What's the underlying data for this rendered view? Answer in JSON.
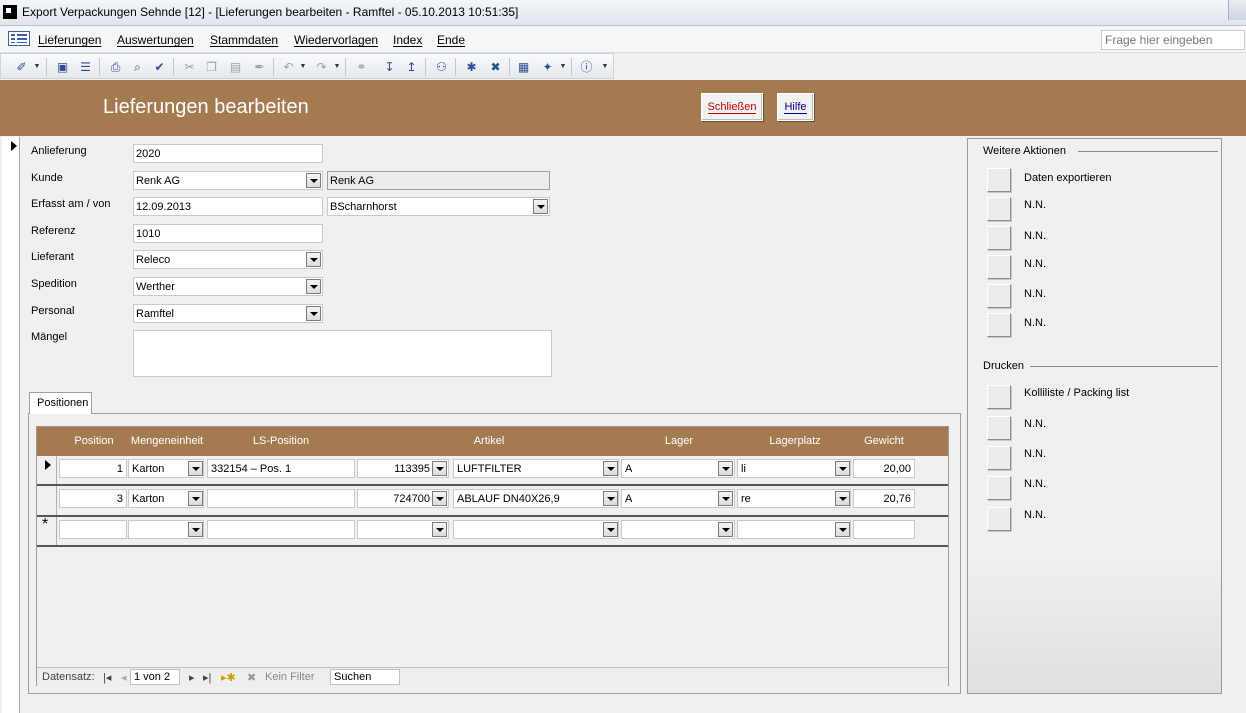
{
  "window": {
    "title": "Export Verpackungen Sehnde [12] - [Lieferungen bearbeiten - Ramftel - 05.10.2013 10:51:35]"
  },
  "menu": {
    "items": [
      "Lieferungen",
      "Auswertungen",
      "Stammdaten",
      "Wiedervorlagen",
      "Index",
      "Ende"
    ],
    "help_placeholder": "Frage hier eingeben"
  },
  "toolbar": {
    "icons": [
      "design-view-icon",
      "save-icon",
      "file-search-icon",
      "print-icon",
      "print-preview-icon",
      "spelling-icon",
      "cut-icon",
      "copy-icon",
      "paste-icon",
      "format-painter-icon",
      "undo-icon",
      "redo-icon",
      "hyperlink-icon",
      "sort-ascending-icon",
      "sort-descending-icon",
      "find-icon",
      "new-record-icon",
      "delete-record-icon",
      "database-window-icon",
      "new-object-icon",
      "help-icon"
    ]
  },
  "header": {
    "title": "Lieferungen bearbeiten",
    "close_label": "Schließen",
    "help_label": "Hilfe"
  },
  "form": {
    "anlieferung_label": "Anlieferung",
    "anlieferung": "2020",
    "kunde_label": "Kunde",
    "kunde": "Renk AG",
    "kunde_name": "Renk AG",
    "erfasst_label": "Erfasst am / von",
    "erfasst_am": "12.09.2013",
    "erfasst_von": "BScharnhorst",
    "referenz_label": "Referenz",
    "referenz": "1010",
    "lieferant_label": "Lieferant",
    "lieferant": "Releco",
    "spedition_label": "Spedition",
    "spedition": "Werther",
    "personal_label": "Personal",
    "personal": "Ramftel",
    "maengel_label": "Mängel",
    "maengel": ""
  },
  "tab": {
    "label": "Positionen"
  },
  "positions": {
    "columns": [
      "Position",
      "Mengeneinheit",
      "LS-Position",
      "Artikel",
      "Lager",
      "Lagerplatz",
      "Gewicht"
    ],
    "rows": [
      {
        "position": "1",
        "mengeneinheit": "Karton",
        "ls_position": "332154 – Pos. 1",
        "artikel_nr": "113395",
        "artikel": "LUFTFILTER",
        "lager": "A",
        "lagerplatz": "li",
        "gewicht": "20,00"
      },
      {
        "position": "3",
        "mengeneinheit": "Karton",
        "ls_position": "",
        "artikel_nr": "724700",
        "artikel": "ABLAUF DN40X26,9",
        "lager": "A",
        "lagerplatz": "re",
        "gewicht": "20,76"
      }
    ],
    "new_row_marker": "*",
    "navigation": {
      "label": "Datensatz:",
      "record": "1 von 2",
      "filter": "Kein Filter",
      "search": "Suchen"
    }
  },
  "weitere_aktionen": {
    "title": "Weitere Aktionen",
    "items": [
      "Daten exportieren",
      "N.N.",
      "N.N.",
      "N.N.",
      "N.N.",
      "N.N."
    ]
  },
  "drucken": {
    "title": "Drucken",
    "items": [
      "Kolliliste / Packing list",
      "N.N.",
      "N.N.",
      "N.N.",
      "N.N."
    ]
  }
}
